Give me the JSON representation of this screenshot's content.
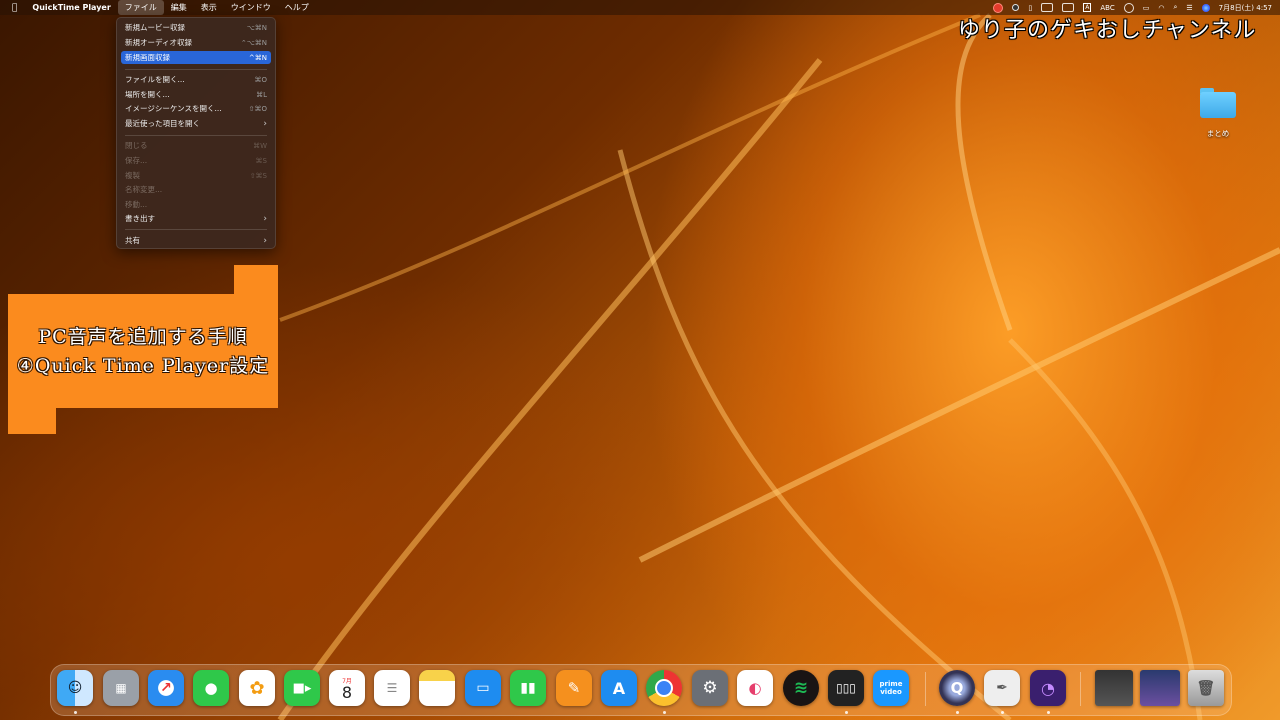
{
  "menubar": {
    "apple_icon": "apple-icon",
    "app_name": "QuickTime Player",
    "menus": [
      "ファイル",
      "編集",
      "表示",
      "ウインドウ",
      "ヘルプ"
    ],
    "active_menu": "ファイル",
    "status": {
      "input_label": "ABC",
      "datetime": "7月8日(土) 4:57"
    }
  },
  "file_menu": {
    "items": [
      {
        "label": "新規ムービー収録",
        "shortcut": "⌥⌘N"
      },
      {
        "label": "新規オーディオ収録",
        "shortcut": "⌃⌥⌘N"
      },
      {
        "label": "新規画面収録",
        "shortcut": "^⌘N",
        "highlighted": true
      },
      {
        "label": "ファイルを開く...",
        "shortcut": "⌘O"
      },
      {
        "label": "場所を開く...",
        "shortcut": "⌘L"
      },
      {
        "label": "イメージシーケンスを開く...",
        "shortcut": "⇧⌘O"
      },
      {
        "label": "最近使った項目を開く",
        "shortcut": "",
        "submenu": true
      },
      {
        "label": "閉じる",
        "shortcut": "⌘W",
        "disabled": true
      },
      {
        "label": "保存...",
        "shortcut": "⌘S",
        "disabled": true
      },
      {
        "label": "複製",
        "shortcut": "⇧⌘S",
        "disabled": true
      },
      {
        "label": "名称変更...",
        "shortcut": "",
        "disabled": true
      },
      {
        "label": "移動...",
        "shortcut": "",
        "disabled": true
      },
      {
        "label": "書き出す",
        "shortcut": "",
        "submenu": true
      },
      {
        "label": "共有",
        "shortcut": "",
        "submenu": true
      }
    ]
  },
  "overlay": {
    "channel_title": "ゆり子のゲキおしチャンネル",
    "note_line1": "PC音声を追加する手順",
    "note_line2": "④Quick Time Player設定"
  },
  "desktop": {
    "folder_label": "まとめ"
  },
  "dock": {
    "calendar_month": "7月",
    "calendar_day": "8",
    "prime_label": "prime video",
    "apps": [
      "finder-icon",
      "launchpad-icon",
      "safari-icon",
      "messages-icon",
      "photos-icon",
      "facetime-icon",
      "calendar-icon",
      "reminders-icon",
      "notes-icon",
      "keynote-icon",
      "numbers-icon",
      "pages-icon",
      "app-store-icon",
      "chrome-icon",
      "system-settings-icon",
      "vrew-icon",
      "spotify-icon",
      "piano-icon",
      "prime-video-icon",
      "quicktime-icon",
      "textedit-icon",
      "app-icon",
      "window-thumbnail-icon",
      "window-thumbnail-icon",
      "trash-icon"
    ]
  }
}
